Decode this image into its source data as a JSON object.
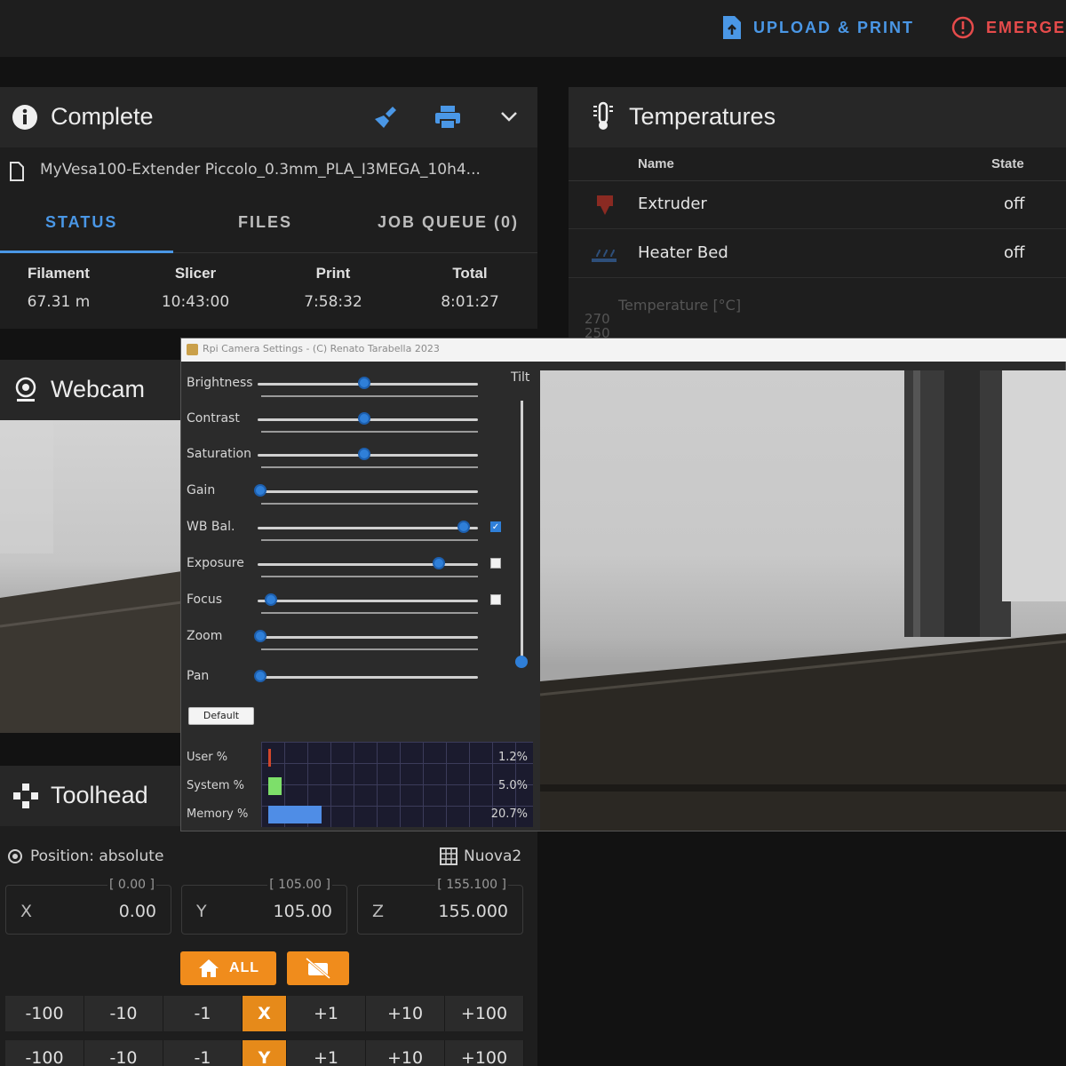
{
  "topbar": {
    "upload_label": "UPLOAD & PRINT",
    "emergency_label": "EMERGE"
  },
  "status": {
    "title": "Complete",
    "filename": "MyVesa100-Extender Piccolo_0.3mm_PLA_I3MEGA_10h4...",
    "tabs": [
      {
        "label": "STATUS",
        "active": true
      },
      {
        "label": "FILES",
        "active": false
      },
      {
        "label": "JOB QUEUE (0)",
        "active": false
      }
    ],
    "stats": [
      {
        "label": "Filament",
        "value": "67.31 m"
      },
      {
        "label": "Slicer",
        "value": "10:43:00"
      },
      {
        "label": "Print",
        "value": "7:58:32"
      },
      {
        "label": "Total",
        "value": "8:01:27"
      }
    ]
  },
  "temperatures": {
    "title": "Temperatures",
    "col_name": "Name",
    "col_state": "State",
    "rows": [
      {
        "name": "Extruder",
        "state": "off"
      },
      {
        "name": "Heater Bed",
        "state": "off"
      }
    ],
    "chart_label": "Temperature [°C]",
    "ticks": [
      "270",
      "250"
    ]
  },
  "webcam": {
    "title": "Webcam"
  },
  "camera_settings": {
    "window_title": "Rpi Camera Settings - (C) Renato Tarabella 2023",
    "tilt_label": "Tilt",
    "tilt_level": 0.02,
    "default_label": "Default",
    "controls": [
      {
        "label": "Brightness",
        "level": 0.5,
        "checkbox": null
      },
      {
        "label": "Contrast",
        "level": 0.5,
        "checkbox": null
      },
      {
        "label": "Saturation",
        "level": 0.5,
        "checkbox": null
      },
      {
        "label": "Gain",
        "level": 0.0,
        "checkbox": null
      },
      {
        "label": "WB Bal.",
        "level": 0.98,
        "checkbox": true
      },
      {
        "label": "Exposure",
        "level": 0.86,
        "checkbox": false
      },
      {
        "label": "Focus",
        "level": 0.05,
        "checkbox": false
      },
      {
        "label": "Zoom",
        "level": 0.0,
        "checkbox": null
      },
      {
        "label": "Pan",
        "level": 0.0,
        "checkbox": null
      }
    ],
    "cpu": [
      {
        "label": "User %",
        "value": "1.2%",
        "level": 0.012,
        "color": "#d0462b"
      },
      {
        "label": "System %",
        "value": "5.0%",
        "level": 0.05,
        "color": "#7ddf6a"
      },
      {
        "label": "Memory %",
        "value": "20.7%",
        "level": 0.207,
        "color": "#4f8de6"
      }
    ]
  },
  "toolhead": {
    "title": "Toolhead",
    "position_label": "Position: absolute",
    "mesh_label": "Nuova2",
    "axes": [
      {
        "axis": "X",
        "value": "0.00",
        "hint": "[ 0.00 ]"
      },
      {
        "axis": "Y",
        "value": "105.00",
        "hint": "[ 105.00 ]"
      },
      {
        "axis": "Z",
        "value": "155.000",
        "hint": "[ 155.100 ]"
      }
    ],
    "home_all_label": "ALL",
    "jog_x": [
      "-100",
      "-10",
      "-1",
      "X",
      "+1",
      "+10",
      "+100"
    ],
    "jog_y": [
      "-100",
      "-10",
      "-1",
      "Y",
      "+1",
      "+10",
      "+100"
    ]
  },
  "colors": {
    "accent": "#4a97e6",
    "emergency": "#e64b4b",
    "home_button": "#f08c1c"
  }
}
